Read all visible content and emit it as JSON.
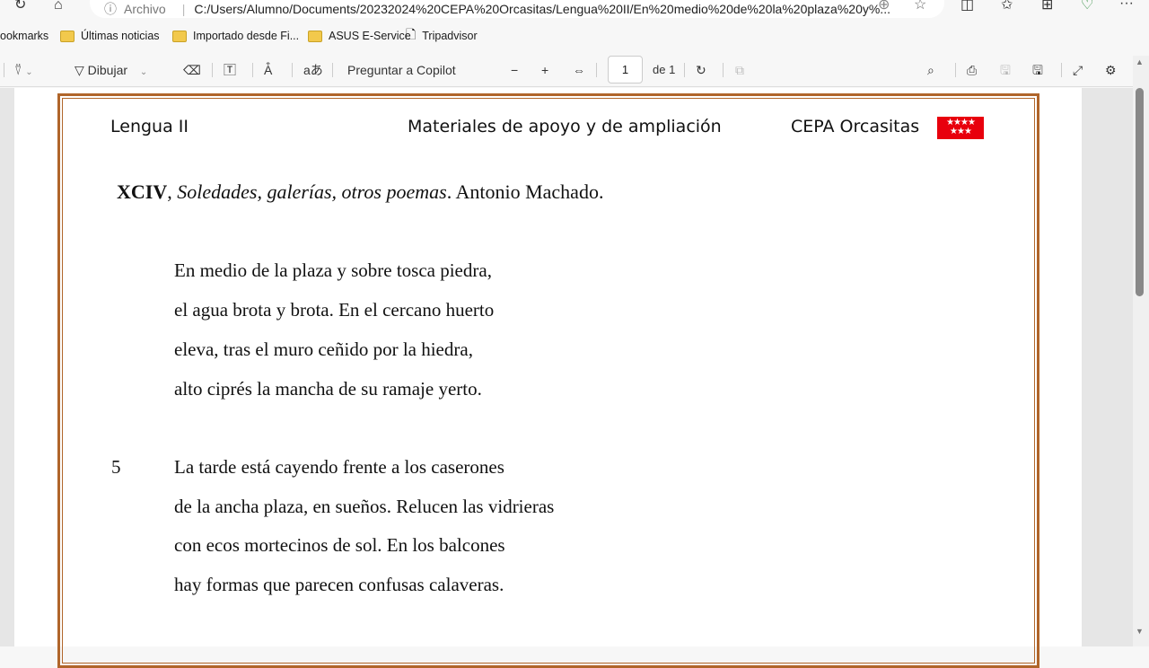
{
  "browser": {
    "address_prefix": "Archivo",
    "url": "C:/Users/Alumno/Documents/20232024%20CEPA%20Orcasitas/Lengua%20II/En%20medio%20de%20la%20plaza%20y%...",
    "bookmarks": [
      "ookmarks",
      "Últimas noticias",
      "Importado desde Fi...",
      "ASUS E-Service",
      "Tripadvisor"
    ]
  },
  "pdf_toolbar": {
    "draw_label": "Dibujar",
    "copilot_label": "Preguntar a Copilot",
    "page_current": "1",
    "page_total": "de 1"
  },
  "document": {
    "header_left": "Lengua II",
    "header_center": "Materiales de apoyo y de ampliación",
    "header_right": "CEPA Orcasitas",
    "flag_stars": "★★★★ ★★★",
    "title_bold": "XCIV",
    "title_sep": ", ",
    "title_italic": "Soledades, galerías, otros poemas",
    "title_author": ". Antonio Machado.",
    "line_number": "5",
    "stanza1": [
      "En medio de la plaza y sobre tosca piedra,",
      "el agua brota y brota. En el cercano huerto",
      "eleva, tras el muro ceñido por la hiedra,",
      "alto ciprés la mancha de su ramaje yerto."
    ],
    "stanza2": [
      "La tarde está cayendo frente a los caserones",
      "de la ancha plaza, en sueños. Relucen las vidrieras",
      "con ecos mortecinos de sol. En los balcones",
      "hay formas que parecen confusas calaveras."
    ]
  }
}
